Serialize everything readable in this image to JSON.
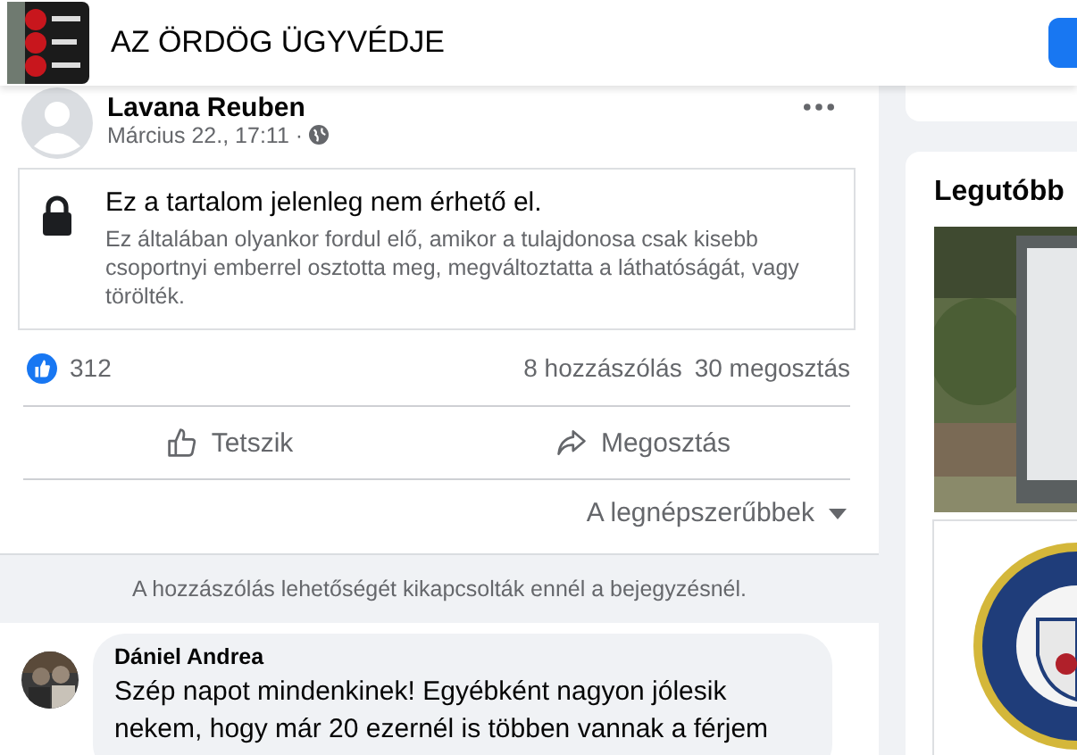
{
  "header": {
    "title": "AZ ÖRDÖG ÜGYVÉDJE"
  },
  "post": {
    "author": "Lavana Reuben",
    "date": "Március 22., 17:11 ·",
    "notice": {
      "title": "Ez a tartalom jelenleg nem érhető el.",
      "text": "Ez általában olyankor fordul elő, amikor a tulajdonosa csak kisebb csoportnyi emberrel osztotta meg, megváltoztatta a láthatóságát, vagy törölték."
    },
    "reactions": "312",
    "comments_count": "8 hozzászólás",
    "shares_count": "30 megosztás",
    "actions": [
      {
        "kind": "like",
        "label": "Tetszik"
      },
      {
        "kind": "share",
        "label": "Megosztás"
      }
    ],
    "sort": "A legnépszerűbbek",
    "comments_disabled": "A hozzászólás lehetőségét kikapcsolták ennél a bejegyzésnél."
  },
  "comment": {
    "author": "Dániel Andrea",
    "text": "Szép napot mindenkinek! Egyébként nagyon jólesik nekem, hogy már 20 ezernél is többen vannak a férjem"
  },
  "sidebar": {
    "title": "Legutóbb"
  }
}
